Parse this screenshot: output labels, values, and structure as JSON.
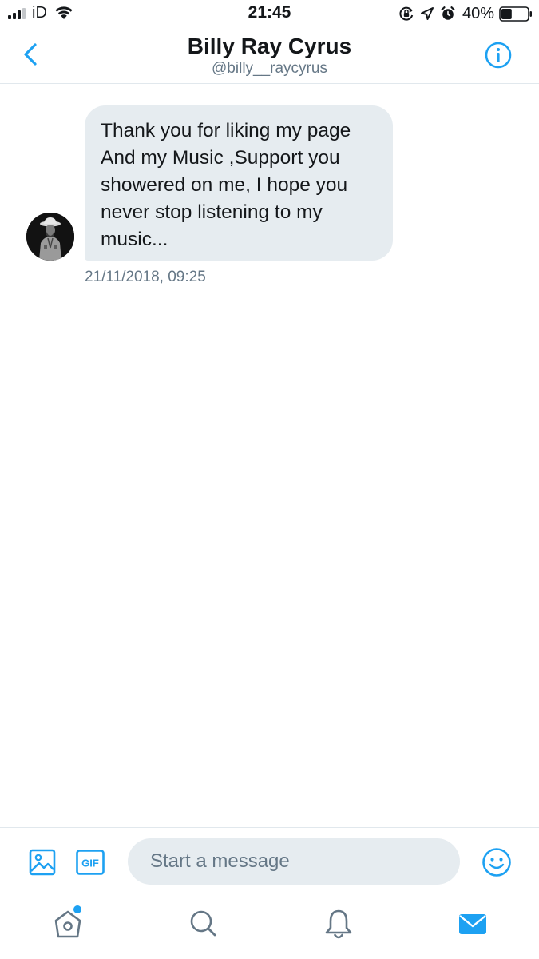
{
  "status_bar": {
    "carrier": "iD",
    "time": "21:45",
    "battery_percent": "40%",
    "battery_level": 0.4,
    "icons": [
      "signal-icon",
      "wifi-icon",
      "orientation-lock-icon",
      "location-arrow-icon",
      "alarm-icon",
      "battery-icon"
    ]
  },
  "header": {
    "title": "Billy Ray Cyrus",
    "handle": "@billy__raycyrus",
    "back_icon": "chevron-left-icon",
    "info_icon": "info-icon"
  },
  "conversation": {
    "messages": [
      {
        "text": "Thank you for liking my page\nAnd my Music ,Support you\nshowered on me, I hope you\nnever stop listening to my\nmusic...",
        "timestamp": "21/11/2018, 09:25"
      }
    ]
  },
  "composer": {
    "placeholder": "Start a message",
    "value": "",
    "gif_label": "GIF",
    "media_icon": "image-icon",
    "emoji_icon": "emoji-icon"
  },
  "tab_bar": {
    "items": [
      {
        "name": "home",
        "icon": "home-icon",
        "has_badge": true
      },
      {
        "name": "search",
        "icon": "search-icon"
      },
      {
        "name": "notifications",
        "icon": "bell-icon"
      },
      {
        "name": "messages",
        "icon": "envelope-icon",
        "active": true
      }
    ]
  },
  "colors": {
    "accent": "#1da1f2",
    "icon_gray": "#657786",
    "bubble": "#e6ecf0",
    "text": "#14171a"
  }
}
